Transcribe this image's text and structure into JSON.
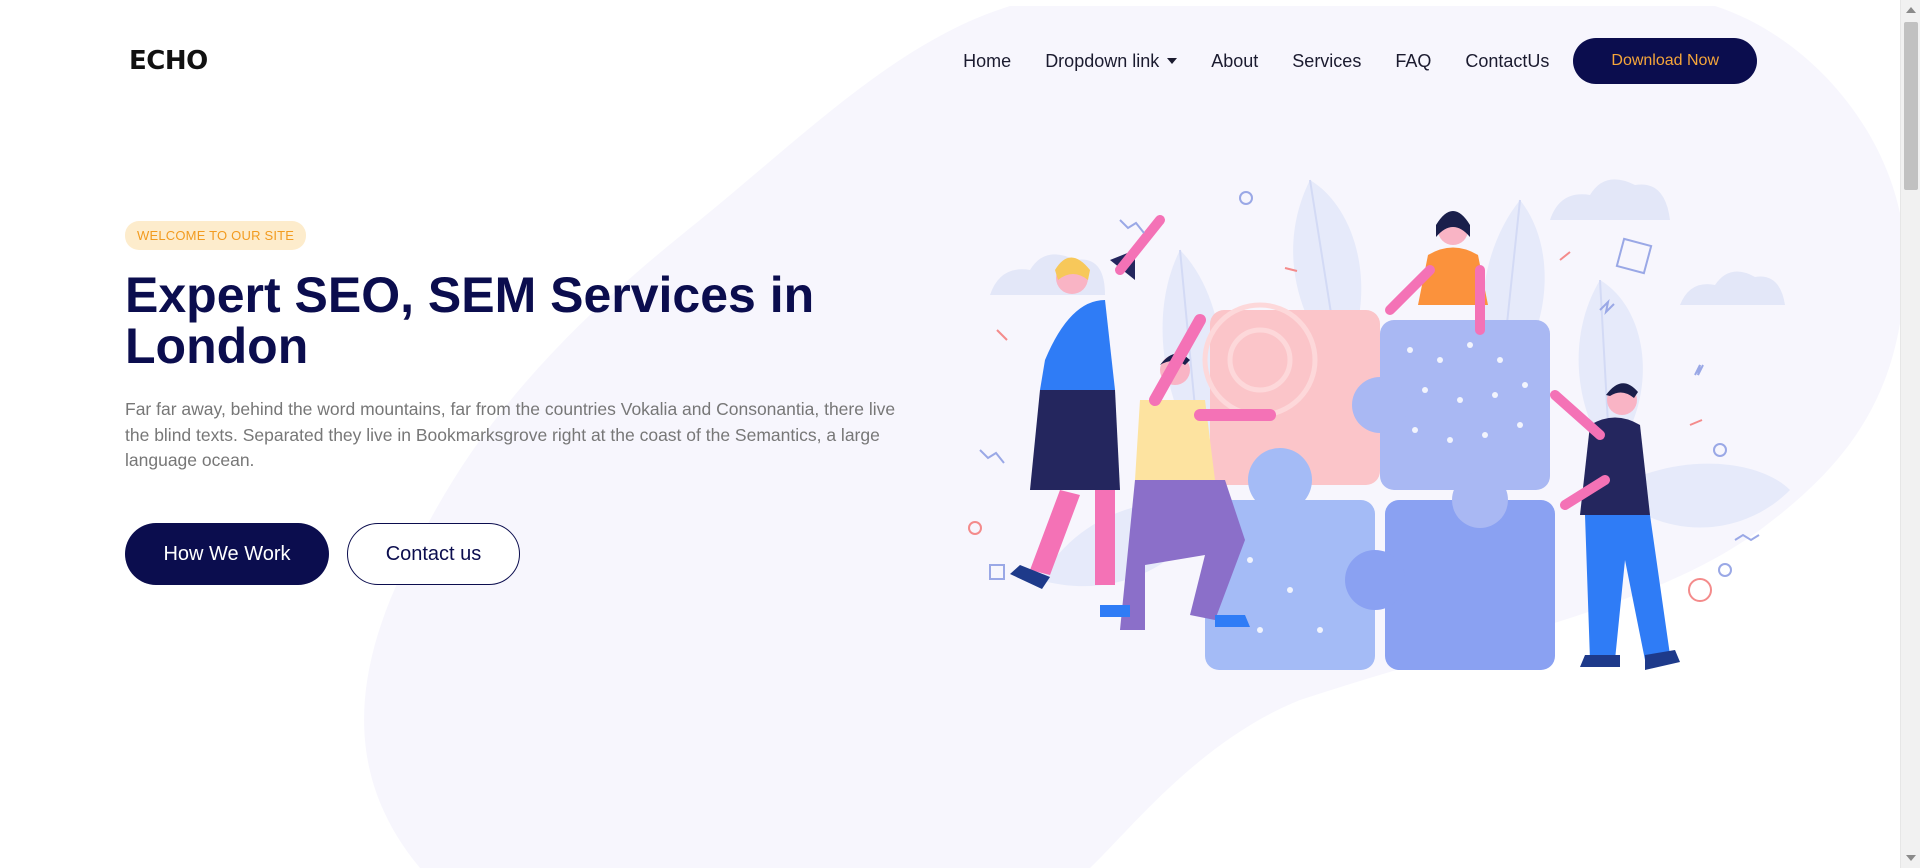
{
  "brand": {
    "logo_text": "ECHO"
  },
  "nav": {
    "items": [
      {
        "label": "Home"
      },
      {
        "label": "Dropdown link"
      },
      {
        "label": "About"
      },
      {
        "label": "Services"
      },
      {
        "label": "FAQ"
      },
      {
        "label": "ContactUs"
      }
    ],
    "cta_label": "Download Now"
  },
  "hero": {
    "badge": "WELCOME TO OUR SITE",
    "title": "Expert SEO, SEM Services in London",
    "lead": "Far far away, behind the word mountains, far from the countries Vokalia and Consonantia, there live the blind texts. Separated they live in Bookmarksgrove right at the coast of the Semantics, a large language ocean.",
    "primary_button": "How We Work",
    "secondary_button": "Contact us"
  },
  "colors": {
    "navy": "#0b0d4e",
    "accent_orange": "#f6a63a",
    "badge_bg": "#fdeccc",
    "blob": "#f7f6fd"
  },
  "illustration": {
    "icon": "team-puzzle-illustration"
  }
}
